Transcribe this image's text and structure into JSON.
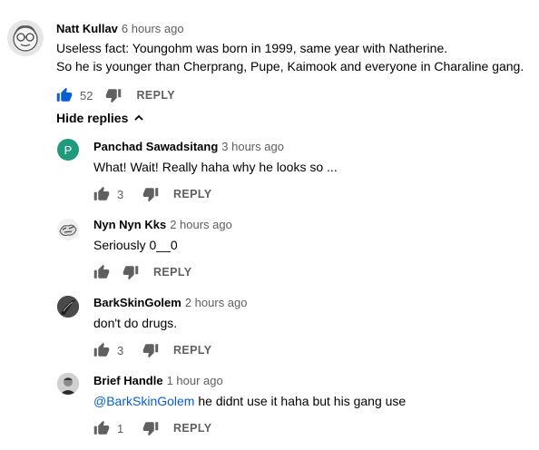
{
  "colors": {
    "link": "#065fd4",
    "liked": "#065fd4",
    "panchad_avatar": "#1e9a7c"
  },
  "top_comment": {
    "author": "Natt Kullav",
    "time": "6 hours ago",
    "line1": "Useless fact:  Youngohm was born in 1999, same year with Natherine.",
    "line2": "So he is younger than Cherprang, Pupe, Kaimook and everyone in Charaline gang.",
    "likes": "52",
    "reply_label": "REPLY"
  },
  "hide_replies_label": "Hide replies",
  "replies": [
    {
      "author": "Panchad Sawadsitang",
      "time": "3 hours ago",
      "text": "What! Wait! Really haha why he looks so ...",
      "likes": "3",
      "reply_label": "REPLY",
      "avatar_letter": "P"
    },
    {
      "author": "Nyn Nyn Kks",
      "time": "2 hours ago",
      "text": "Seriously 0__0",
      "likes": "",
      "reply_label": "REPLY"
    },
    {
      "author": "BarkSkinGolem",
      "time": "2 hours ago",
      "text": "don't do drugs.",
      "likes": "3",
      "reply_label": "REPLY"
    },
    {
      "author": "Brief Handle",
      "time": "1 hour ago",
      "mention": "@BarkSkinGolem",
      "text": " he didnt use it haha but his gang use",
      "likes": "1",
      "reply_label": "REPLY"
    }
  ]
}
